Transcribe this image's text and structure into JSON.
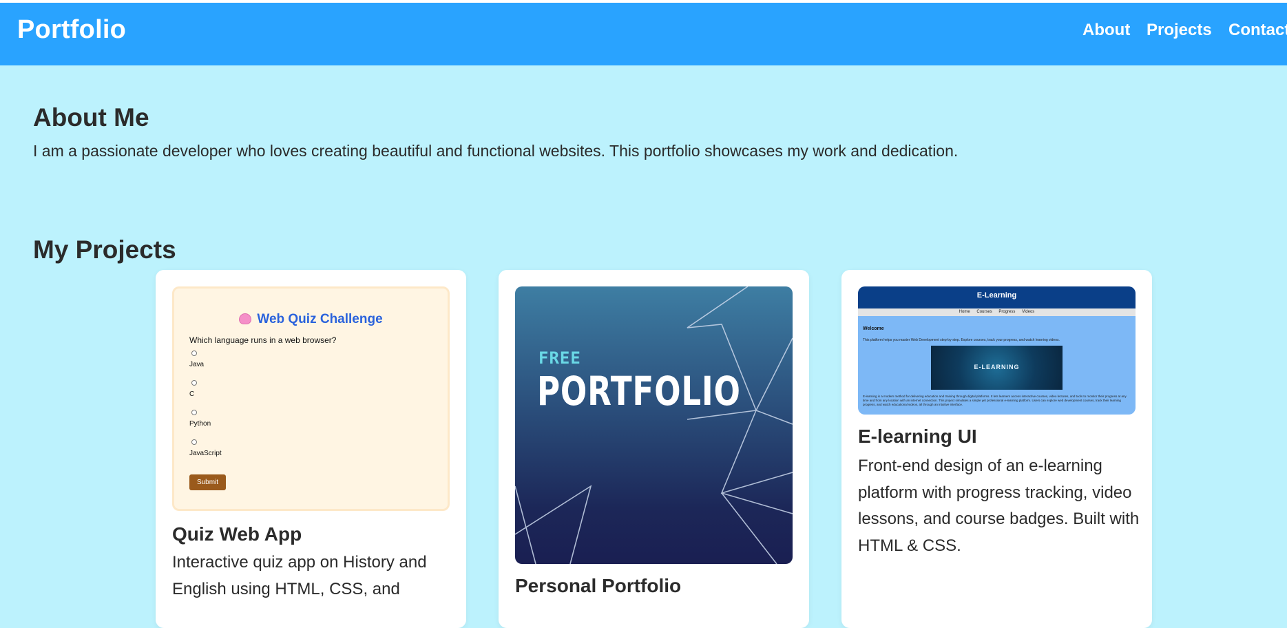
{
  "header": {
    "brand": "Portfolio",
    "nav": [
      "About",
      "Projects",
      "Contact"
    ]
  },
  "about": {
    "title": "About Me",
    "text": "I am a passionate developer who loves creating beautiful and functional websites. This portfolio showcases my work and dedication."
  },
  "projects": {
    "title": "My Projects",
    "cards": [
      {
        "title": "Quiz Web App",
        "description": "Interactive quiz app on History and English using HTML, CSS, and",
        "thumbnail": {
          "heading": "Web Quiz Challenge",
          "icon": "brain-icon",
          "question": "Which language runs in a web browser?",
          "options": [
            "Java",
            "C",
            "Python",
            "JavaScript"
          ],
          "button": "Submit"
        }
      },
      {
        "title": "Personal Portfolio",
        "description": "",
        "thumbnail": {
          "free": "FREE",
          "portfolio": "PORTFOLIO"
        }
      },
      {
        "title": "E-learning UI",
        "description": "Front-end design of an e-learning platform with progress tracking, video lessons, and course badges. Built with HTML & CSS.",
        "thumbnail": {
          "header": "E-Learning",
          "nav": [
            "Home",
            "Courses",
            "Progress",
            "Videos"
          ],
          "welcome": "Welcome",
          "intro": "This platform helps you master Web Development step-by-step. Explore courses, track your progress, and watch learning videos.",
          "banner": "E-LEARNING",
          "paragraph": "E-learning is a modern method for delivering education and training through digital platforms. It lets learners access interactive courses, video lectures, and tools to monitor their progress at any time and from any location with an internet connection. This project simulates a simple yet professional e-learning platform. Users can explore web development courses, track their learning progress, and watch educational videos, all through an intuitive interface."
        }
      }
    ]
  },
  "colors": {
    "header_bg": "#29a3ff",
    "page_bg": "#bcf2fd",
    "quiz_heading": "#2a62dc",
    "submit_button": "#9a5a1c"
  }
}
